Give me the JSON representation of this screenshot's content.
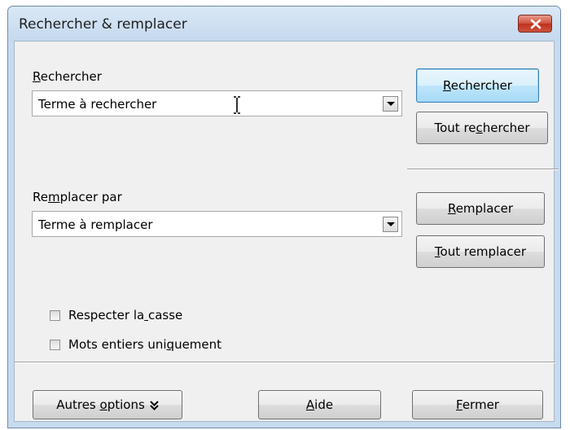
{
  "window": {
    "title": "Rechercher & remplacer"
  },
  "search": {
    "label": "Rechercher",
    "value": "Terme à rechercher"
  },
  "replace": {
    "label": "Remplacer par",
    "value": "Terme à remplacer"
  },
  "buttons": {
    "find": "Rechercher",
    "find_all": "Tout rechercher",
    "replace": "Remplacer",
    "replace_all": "Tout remplacer",
    "more_options": "Autres options",
    "help": "Aide",
    "close": "Fermer"
  },
  "options": {
    "match_case": {
      "label": "Respecter la casse",
      "checked": false
    },
    "whole_words": {
      "label": "Mots entiers uniquement",
      "checked": false
    }
  },
  "icons": {
    "close": "close-icon",
    "dropdown": "dropdown-arrow-icon",
    "text_cursor": "text-cursor-icon",
    "more_options": "double-chevron-down-icon"
  },
  "colors": {
    "title_bar": "#c7dbef",
    "close_button": "#c8432f",
    "default_button": "#bee6fd",
    "dialog_background": "#f0f0f0"
  }
}
